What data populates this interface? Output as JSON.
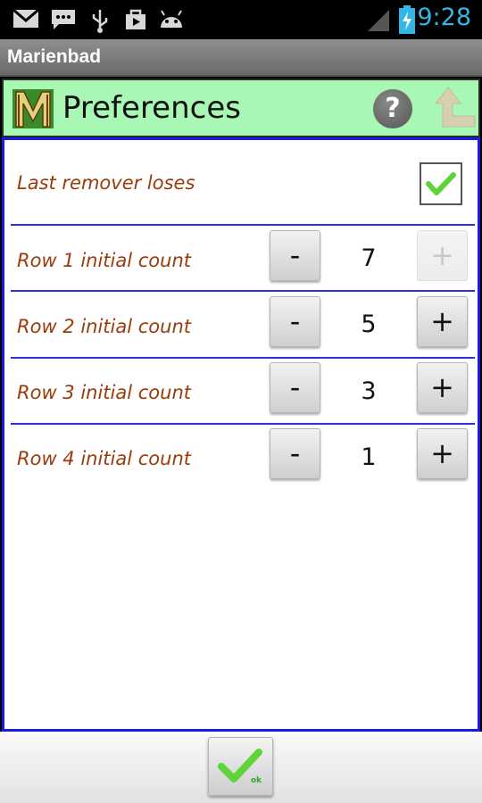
{
  "status_bar": {
    "time": "9:28",
    "icons": [
      "gmail-icon",
      "messaging-icon",
      "usb-icon",
      "media-icon",
      "android-icon",
      "signal-icon",
      "battery-icon"
    ],
    "accent_color": "#33b5e5"
  },
  "app": {
    "title": "Marienbad"
  },
  "header": {
    "title": "Preferences",
    "help_label": "?",
    "background_color": "#a8f7b4"
  },
  "settings": {
    "last_remover": {
      "label": "Last remover loses",
      "checked": true
    },
    "rows": [
      {
        "label": "Row 1 initial count",
        "value": "7",
        "minus_label": "-",
        "plus_label": "+",
        "plus_enabled": false
      },
      {
        "label": "Row 2 initial count",
        "value": "5",
        "minus_label": "-",
        "plus_label": "+",
        "plus_enabled": true
      },
      {
        "label": "Row 3 initial count",
        "value": "3",
        "minus_label": "-",
        "plus_label": "+",
        "plus_enabled": true
      },
      {
        "label": "Row 4 initial count",
        "value": "1",
        "minus_label": "-",
        "plus_label": "+",
        "plus_enabled": true
      }
    ]
  },
  "footer": {
    "ok_label": "ok"
  },
  "colors": {
    "label_text": "#9c3a0c",
    "border": "#1a1ae6",
    "check_green": "#5fd43a"
  }
}
